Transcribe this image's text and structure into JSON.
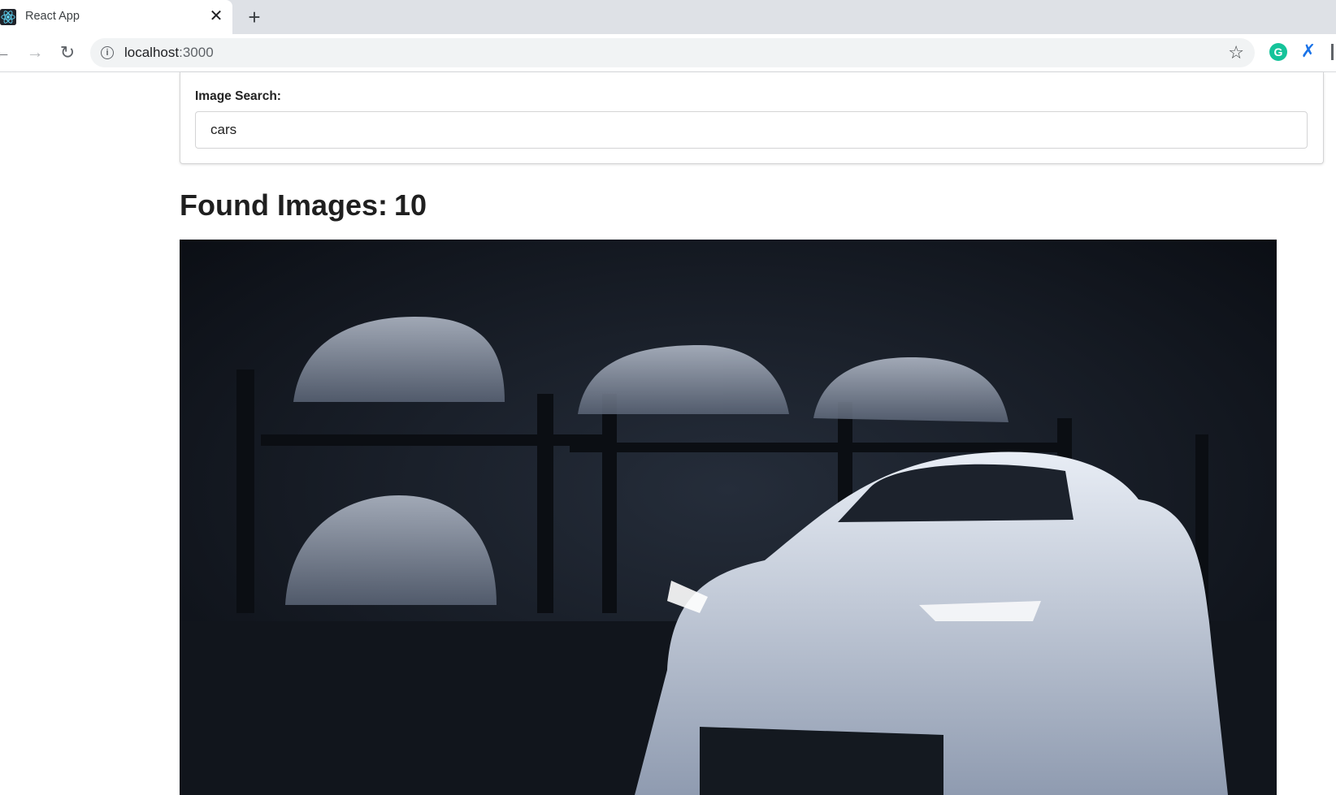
{
  "browser": {
    "tab": {
      "title": "React App",
      "favicon": "react-logo-icon",
      "close_glyph": "✕"
    },
    "new_tab_glyph": "+",
    "toolbar": {
      "back_glyph": "←",
      "forward_glyph": "→",
      "reload_glyph": "↻",
      "url_host": "localhost",
      "url_port": ":3000",
      "star_glyph": "☆",
      "extensions": [
        "grammarly-icon",
        "tools-extension-icon"
      ]
    }
  },
  "search": {
    "label": "Image Search:",
    "value": "cars"
  },
  "results": {
    "heading": "Found Images:",
    "count": "10",
    "first_image": "dark-garage-white-sports-cars-photo"
  },
  "colors": {
    "tabstrip": "#dee1e6",
    "omnibox": "#f1f3f4",
    "grammarly": "#15c39a"
  }
}
